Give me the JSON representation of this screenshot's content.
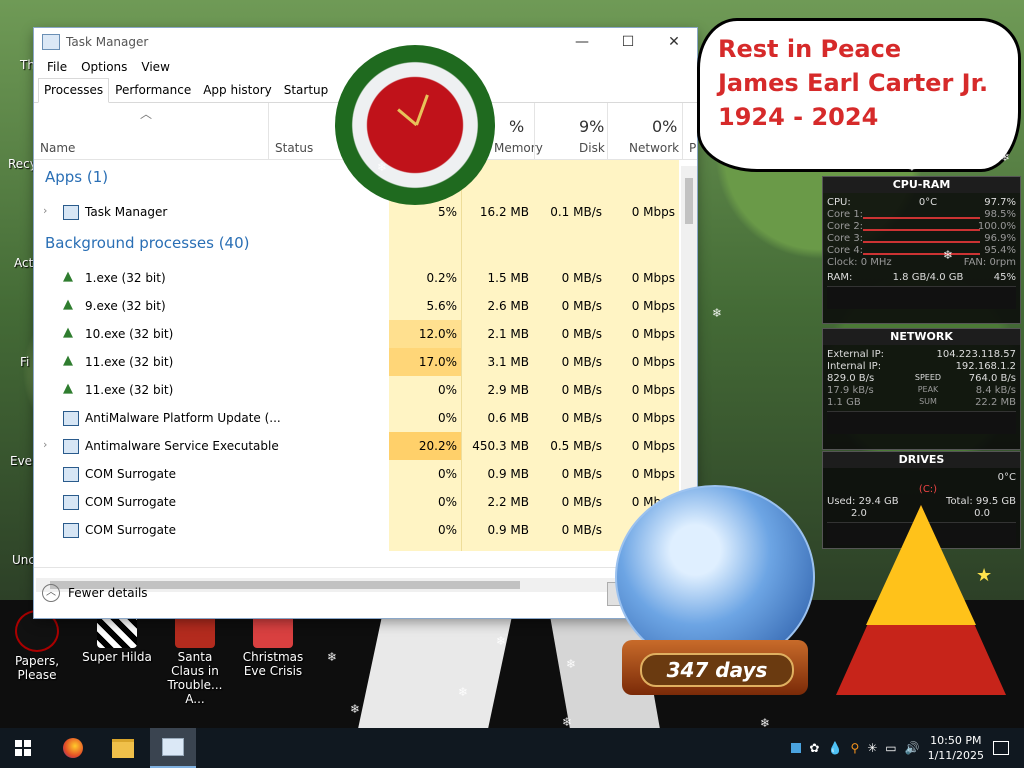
{
  "taskmanager": {
    "title": "Task Manager",
    "menu": [
      "File",
      "Options",
      "View"
    ],
    "tabs": [
      "Processes",
      "Performance",
      "App history",
      "Startup"
    ],
    "headers": {
      "name": "Name",
      "status": "Status",
      "memory": "Memory",
      "disk": "Disk",
      "network": "Network",
      "power": "P",
      "cpu_pct": "%",
      "memory_pct": "%",
      "disk_pct": "9%",
      "network_pct": "0%"
    },
    "groups": {
      "apps": "Apps (1)",
      "background": "Background processes (40)"
    },
    "rows": [
      {
        "name": "Task Manager",
        "icon": "window-icon",
        "expand": true,
        "cpu": "5%",
        "mem": "16.2 MB",
        "disk": "0.1 MB/s",
        "net": "0 Mbps"
      },
      {
        "name": "1.exe (32 bit)",
        "icon": "tree-icon",
        "expand": false,
        "cpu": "0.2%",
        "mem": "1.5 MB",
        "disk": "0 MB/s",
        "net": "0 Mbps"
      },
      {
        "name": "9.exe (32 bit)",
        "icon": "tree-icon",
        "expand": false,
        "cpu": "5.6%",
        "mem": "2.6 MB",
        "disk": "0 MB/s",
        "net": "0 Mbps"
      },
      {
        "name": "10.exe (32 bit)",
        "icon": "tree-icon",
        "expand": false,
        "cpu": "12.0%",
        "mem": "2.1 MB",
        "disk": "0 MB/s",
        "net": "0 Mbps"
      },
      {
        "name": "11.exe (32 bit)",
        "icon": "tree-icon",
        "expand": false,
        "cpu": "17.0%",
        "mem": "3.1 MB",
        "disk": "0 MB/s",
        "net": "0 Mbps"
      },
      {
        "name": "11.exe (32 bit)",
        "icon": "tree-icon",
        "expand": false,
        "cpu": "0%",
        "mem": "2.9 MB",
        "disk": "0 MB/s",
        "net": "0 Mbps"
      },
      {
        "name": "AntiMalware Platform Update (...",
        "icon": "window-icon",
        "expand": false,
        "cpu": "0%",
        "mem": "0.6 MB",
        "disk": "0 MB/s",
        "net": "0 Mbps"
      },
      {
        "name": "Antimalware Service Executable",
        "icon": "window-icon",
        "expand": true,
        "cpu": "20.2%",
        "mem": "450.3 MB",
        "disk": "0.5 MB/s",
        "net": "0 Mbps"
      },
      {
        "name": "COM Surrogate",
        "icon": "window-icon",
        "expand": false,
        "cpu": "0%",
        "mem": "0.9 MB",
        "disk": "0 MB/s",
        "net": "0 Mbps"
      },
      {
        "name": "COM Surrogate",
        "icon": "window-icon",
        "expand": false,
        "cpu": "0%",
        "mem": "2.2 MB",
        "disk": "0 MB/s",
        "net": "0 Mbps"
      },
      {
        "name": "COM Surrogate",
        "icon": "window-icon",
        "expand": false,
        "cpu": "0%",
        "mem": "0.9 MB",
        "disk": "0 MB/s",
        "net": "0 Mbps"
      }
    ],
    "footer": "Fewer details"
  },
  "rip": [
    "Rest in Peace",
    "James Earl Carter Jr.",
    "1924 - 2024"
  ],
  "cpu_widget": {
    "title": "CPU-RAM",
    "cpu_label": "CPU:",
    "temp": "0°C",
    "cpu": "97.7%",
    "cores": [
      {
        "label": "Core 1:",
        "value": "98.5%"
      },
      {
        "label": "Core 2:",
        "value": "100.0%"
      },
      {
        "label": "Core 3:",
        "value": "96.9%"
      },
      {
        "label": "Core 4:",
        "value": "95.4%"
      }
    ],
    "clock": "Clock: 0 MHz",
    "fan": "FAN: 0rpm",
    "ram_label": "RAM:",
    "ram": "1.8 GB/4.0 GB",
    "ram_pct": "45%"
  },
  "net_widget": {
    "title": "NETWORK",
    "ext_label": "External IP:",
    "ext": "104.223.118.57",
    "int_label": "Internal IP:",
    "int": "192.168.1.2",
    "speed_in": "829.0 B/s",
    "speed_label": "SPEED",
    "speed_out": "764.0 B/s",
    "peak_in": "17.9 kB/s",
    "peak_label": "PEAK",
    "peak_out": "8.4 kB/s",
    "sum_in": "1.1 GB",
    "sum_label": "SUM",
    "sum_out": "22.2 MB"
  },
  "drives_widget": {
    "title": "DRIVES",
    "temp": "0°C",
    "drive": "(C:)",
    "used": "Used: 29.4 GB",
    "total": "Total: 99.5 GB",
    "read": "2.0",
    "write": "0.0"
  },
  "globe": {
    "days": "347 days"
  },
  "desktop_icons": [
    {
      "label": "Papers, Please"
    },
    {
      "label": "Super Hilda"
    },
    {
      "label": "Santa Claus in Trouble... A..."
    },
    {
      "label": "Christmas Eve Crisis"
    }
  ],
  "desktop_edge_labels": [
    "Th",
    "Recy",
    "Act",
    "Fi",
    "Ever",
    "Unc"
  ],
  "taskbar": {
    "time": "10:50 PM",
    "date": "1/11/2025"
  },
  "colors": {
    "accent": "#2a6fb5",
    "heat": "#fff4c4",
    "heat_hi": "#ffdd88"
  }
}
